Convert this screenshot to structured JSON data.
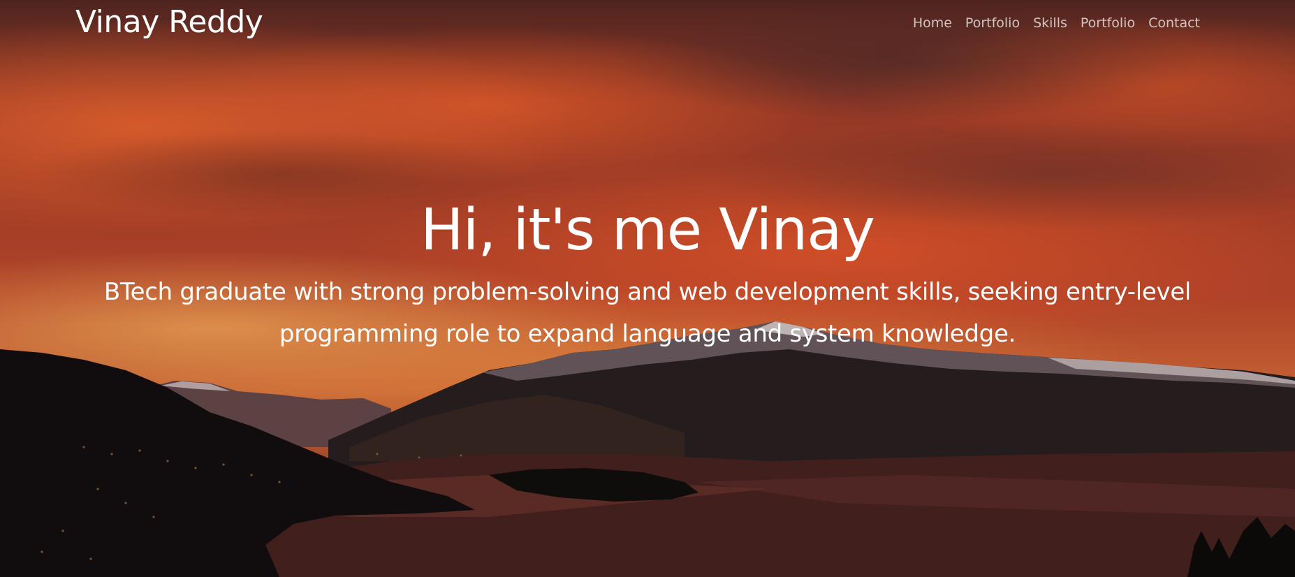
{
  "brand": {
    "name": "Vinay Reddy"
  },
  "nav": {
    "items": [
      {
        "label": "Home"
      },
      {
        "label": "Portfolio"
      },
      {
        "label": "Skills"
      },
      {
        "label": "Portfolio"
      },
      {
        "label": "Contact"
      }
    ]
  },
  "hero": {
    "title": "Hi, it's me Vinay",
    "subtitle": "BTech graduate with strong problem-solving and web development skills, seeking entry-level programming role to expand language and system knowledge."
  },
  "colors": {
    "text": "#ffffff",
    "nav_text": "rgba(255,255,255,0.72)",
    "sky_orange": "#e0703c",
    "mountain_dark": "#1a1414"
  }
}
